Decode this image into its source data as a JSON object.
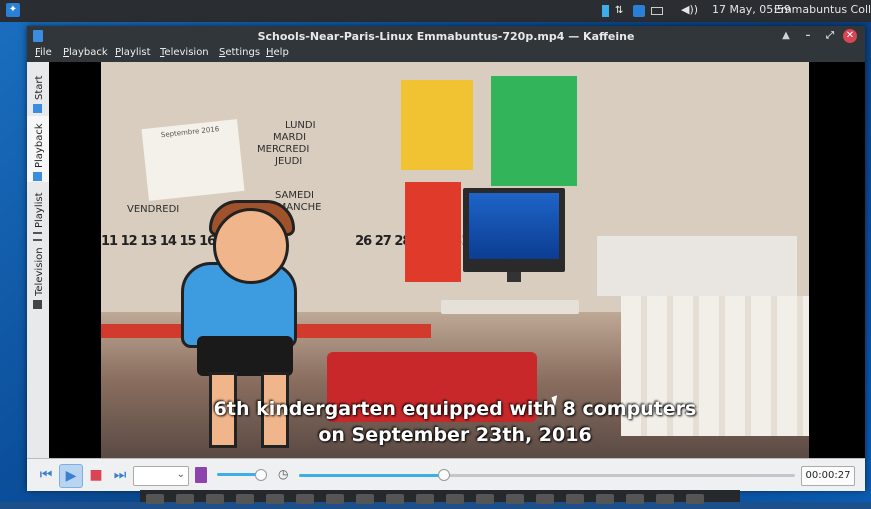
{
  "panel": {
    "clock": "17 May, 05:59",
    "user": "Emmabuntus Collectiv",
    "tray_icons": [
      "storage-icon",
      "network-icon",
      "sync-icon",
      "battery-icon",
      "volume-icon"
    ]
  },
  "window": {
    "title": "Schools-Near-Paris-Linux Emmabuntus-720p.mp4 — Kaffeine",
    "buttons": [
      "keep-above-icon",
      "minimize-icon",
      "maximize-icon",
      "close-icon"
    ]
  },
  "menubar": {
    "items": [
      "File",
      "Playback",
      "Playlist",
      "Television",
      "Settings",
      "Help"
    ]
  },
  "sidetabs": {
    "items": [
      {
        "label": "Start",
        "active": false
      },
      {
        "label": "Playback",
        "active": true
      },
      {
        "label": "Playlist",
        "active": false
      },
      {
        "label": "Television",
        "active": false
      }
    ]
  },
  "video": {
    "subtitle_line1": "6th kindergarten equipped with 8 computers",
    "subtitle_line2": "on September 23th, 2016",
    "words": [
      "LUNDI",
      "MARDI",
      "MERCREDI",
      "JEUDI",
      "SAMEDI",
      "DIMANCHE",
      "VENDREDI"
    ],
    "numbers": "11 12 13 14 15 16 17 18 19 2",
    "numbers2": "26 27 28 29 30 31",
    "calendar_title": "Septembre 2016"
  },
  "controls": {
    "volume_level": 0.85,
    "seek_position": 0.29,
    "time": "00:00:27",
    "combo_value": ""
  },
  "colors": {
    "accent": "#3daee9",
    "close": "#da4453",
    "chrome": "#31363b"
  }
}
